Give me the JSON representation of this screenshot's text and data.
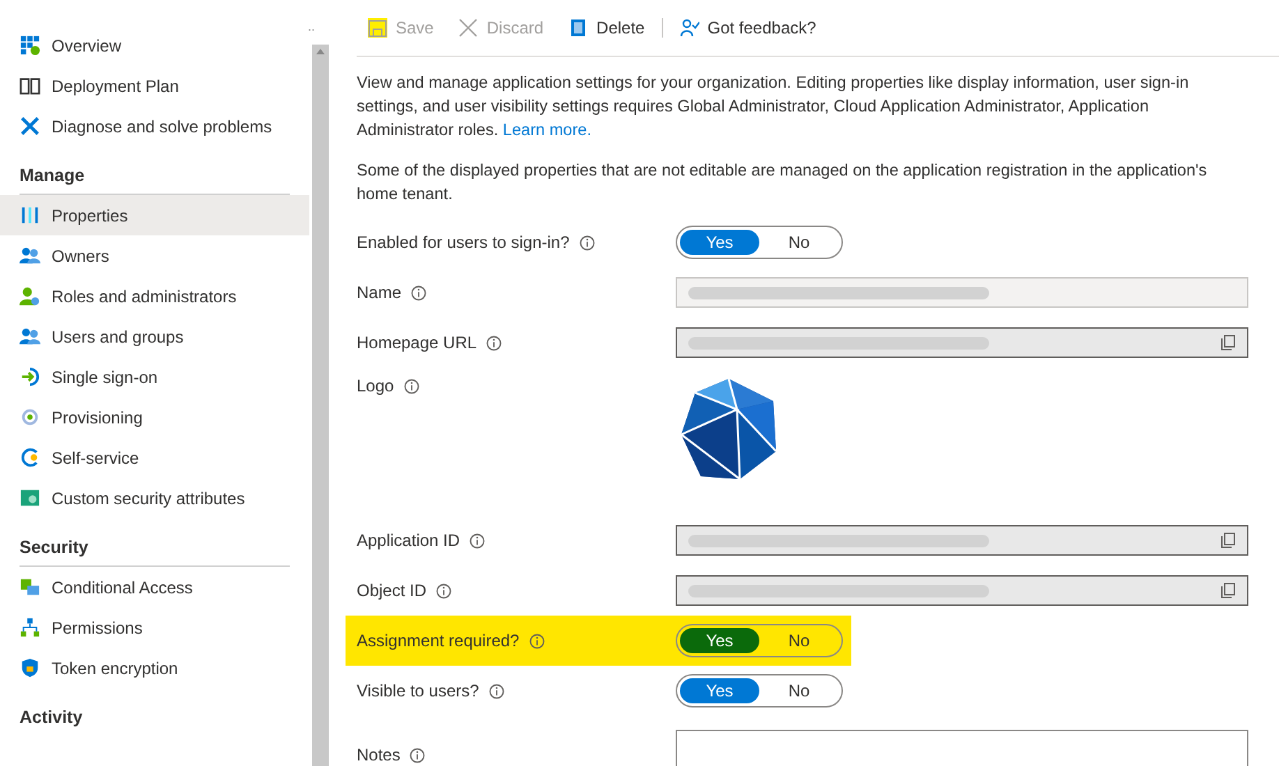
{
  "sidebar": {
    "collapse_mark": "..",
    "sections": [
      {
        "items": [
          {
            "label": "Overview",
            "selected": false
          },
          {
            "label": "Deployment Plan",
            "selected": false
          },
          {
            "label": "Diagnose and solve problems",
            "selected": false
          }
        ]
      },
      {
        "title": "Manage",
        "items": [
          {
            "label": "Properties",
            "selected": true
          },
          {
            "label": "Owners",
            "selected": false
          },
          {
            "label": "Roles and administrators",
            "selected": false
          },
          {
            "label": "Users and groups",
            "selected": false
          },
          {
            "label": "Single sign-on",
            "selected": false
          },
          {
            "label": "Provisioning",
            "selected": false
          },
          {
            "label": "Self-service",
            "selected": false
          },
          {
            "label": "Custom security attributes",
            "selected": false
          }
        ]
      },
      {
        "title": "Security",
        "items": [
          {
            "label": "Conditional Access",
            "selected": false
          },
          {
            "label": "Permissions",
            "selected": false
          },
          {
            "label": "Token encryption",
            "selected": false
          }
        ]
      },
      {
        "title": "Activity"
      }
    ]
  },
  "toolbar": [
    {
      "label": "Save",
      "disabled": true,
      "highlighted": true
    },
    {
      "label": "Discard",
      "disabled": true,
      "highlighted": false
    },
    {
      "label": "Delete",
      "disabled": false,
      "highlighted": false
    },
    {
      "label": "Got feedback?",
      "disabled": false,
      "highlighted": false
    }
  ],
  "intro": [
    "View and manage application settings for your organization. Editing properties like display information, user sign-in settings, and user visibility settings requires Global Administrator, Cloud Application Administrator, Application Administrator roles.",
    "Some of the displayed properties that are not editable are managed on the application registration in the application's home tenant."
  ],
  "learn_more": "Learn more.",
  "fields": [
    {
      "kind": "toggle",
      "label": "Enabled for users to sign-in?",
      "highlighted": false,
      "options": [
        {
          "label": "Yes",
          "selected": true
        },
        {
          "label": "No",
          "selected": false
        }
      ]
    },
    {
      "kind": "text",
      "label": "Name",
      "highlighted": false,
      "redacted": true,
      "copyable": false
    },
    {
      "kind": "text",
      "label": "Homepage URL",
      "highlighted": false,
      "redacted": true,
      "copyable": true
    },
    {
      "kind": "logo",
      "label": "Logo",
      "highlighted": false
    },
    {
      "kind": "text",
      "label": "Application ID",
      "highlighted": false,
      "redacted": true,
      "copyable": true
    },
    {
      "kind": "text",
      "label": "Object ID",
      "highlighted": false,
      "redacted": true,
      "copyable": true
    },
    {
      "kind": "toggle",
      "label": "Assignment required?",
      "highlighted": true,
      "options": [
        {
          "label": "Yes",
          "selected": true
        },
        {
          "label": "No",
          "selected": false
        }
      ]
    },
    {
      "kind": "toggle",
      "label": "Visible to users?",
      "highlighted": false,
      "options": [
        {
          "label": "Yes",
          "selected": true
        },
        {
          "label": "No",
          "selected": false
        }
      ]
    },
    {
      "kind": "notes",
      "label": "Notes",
      "highlighted": false
    }
  ]
}
